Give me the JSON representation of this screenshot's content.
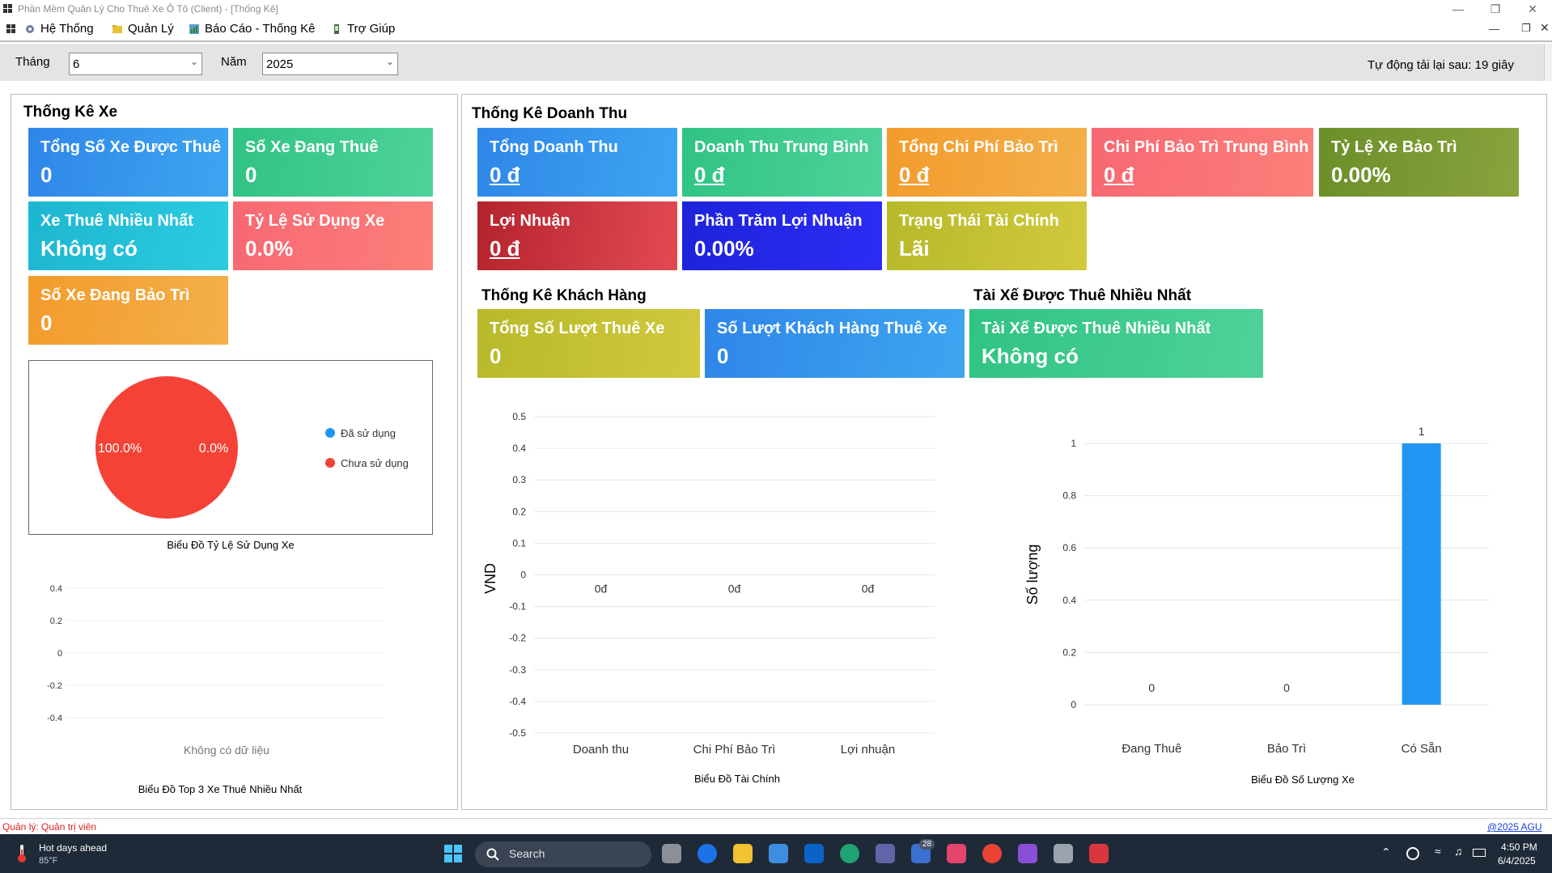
{
  "window": {
    "title": "Phần Mềm Quản Lý Cho Thuê Xe Ô Tô (Client) - [Thống Kê]"
  },
  "menu": {
    "items": [
      {
        "label": "Hệ Thống",
        "icon": "gear-icon"
      },
      {
        "label": "Quản Lý",
        "icon": "folder-icon"
      },
      {
        "label": "Báo Cáo - Thống Kê",
        "icon": "report-icon"
      },
      {
        "label": "Trợ Giúp",
        "icon": "help-icon"
      }
    ]
  },
  "filter": {
    "month_label": "Tháng",
    "month_value": "6",
    "year_label": "Năm",
    "year_value": "2025",
    "auto_reload": "Tự động tải lại sau: 19 giây"
  },
  "car_stats": {
    "title": "Thống Kê Xe",
    "cards": [
      {
        "title": "Tổng Số Xe Được Thuê",
        "value": "0"
      },
      {
        "title": "Số Xe Đang Thuê",
        "value": "0"
      },
      {
        "title": "Xe Thuê Nhiều Nhất",
        "value": "Không có"
      },
      {
        "title": "Tỷ Lệ Sử Dụng Xe",
        "value": "0.0%"
      },
      {
        "title": "Số Xe Đang Bảo Trì",
        "value": "0"
      }
    ]
  },
  "revenue_stats": {
    "title": "Thống Kê Doanh Thu",
    "cards": [
      {
        "title": "Tổng Doanh Thu",
        "value": "0 đ"
      },
      {
        "title": "Doanh Thu Trung Bình",
        "value": "0 đ"
      },
      {
        "title": "Tổng Chi Phí Bảo Trì",
        "value": "0 đ"
      },
      {
        "title": "Chi Phí Bảo Trì Trung Bình",
        "value": "0 đ"
      },
      {
        "title": "Tỷ Lệ Xe Bảo Trì",
        "value": "0.00%"
      },
      {
        "title": "Lợi Nhuận",
        "value": "0 đ"
      },
      {
        "title": "Phần Trăm Lợi Nhuận",
        "value": "0.00%"
      },
      {
        "title": "Trạng Thái Tài Chính",
        "value": "Lãi"
      }
    ]
  },
  "customer_stats": {
    "title": "Thống Kê Khách Hàng",
    "cards": [
      {
        "title": "Tổng Số Lượt Thuê Xe",
        "value": "0"
      },
      {
        "title": "Số Lượt Khách Hàng Thuê Xe",
        "value": "0"
      }
    ]
  },
  "driver_stats": {
    "title": "Tài Xế Được Thuê Nhiều Nhất",
    "cards": [
      {
        "title": "Tài Xế Được Thuê Nhiều Nhất",
        "value": "Không có"
      }
    ]
  },
  "chart_data": [
    {
      "type": "pie",
      "title": "Biểu Đồ Tỷ Lệ Sử Dụng Xe",
      "categories": [
        "Đã sử dụng",
        "Chưa sử dụng"
      ],
      "values": [
        0,
        100
      ],
      "labels": [
        "0.0%",
        "100.0%"
      ],
      "colors": [
        "#2196f3",
        "#f44336"
      ],
      "legend": "right"
    },
    {
      "type": "bar",
      "title": "Biểu Đồ Top 3 Xe Thuê Nhiều Nhất",
      "categories": [],
      "values": [],
      "ylim": [
        -0.4,
        0.4
      ],
      "yticks": [
        "0.4",
        "0.2",
        "0",
        "-0.2",
        "-0.4"
      ],
      "empty_text": "Không có dữ liệu"
    },
    {
      "type": "bar",
      "title": "Biểu Đồ Tài Chính",
      "categories": [
        "Doanh thu",
        "Chi Phí Bảo Trì",
        "Lợi nhuận"
      ],
      "values": [
        0,
        0,
        0
      ],
      "value_labels": [
        "0đ",
        "0đ",
        "0đ"
      ],
      "ylabel": "VND",
      "ylim": [
        -0.5,
        0.5
      ],
      "yticks": [
        "0.5",
        "0.4",
        "0.3",
        "0.2",
        "0.1",
        "0",
        "-0.1",
        "-0.2",
        "-0.3",
        "-0.4",
        "-0.5"
      ],
      "grid": true
    },
    {
      "type": "bar",
      "title": "Biểu Đồ Số Lượng Xe",
      "categories": [
        "Đang Thuê",
        "Bảo Trì",
        "Có Sẵn"
      ],
      "values": [
        0,
        0,
        1
      ],
      "value_labels": [
        "0",
        "0",
        "1"
      ],
      "ylabel": "Số lượng",
      "ylim": [
        0,
        1
      ],
      "yticks": [
        "1",
        "0.8",
        "0.6",
        "0.4",
        "0.2",
        "0"
      ],
      "color": "#2196f3",
      "grid": true
    }
  ],
  "statusbar": {
    "manager": "Quản lý: Quản trị viên",
    "copyright": "@2025 AGU"
  },
  "taskbar": {
    "weather_title": "Hot days ahead",
    "weather_temp": "85°F",
    "search_placeholder": "Search",
    "teams_badge": "28",
    "time": "4:50 PM",
    "date": "6/4/2025"
  }
}
